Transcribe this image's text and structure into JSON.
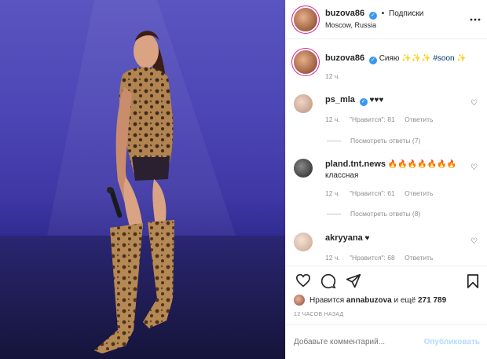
{
  "post": {
    "username": "buzova86",
    "follow_label": "Подписки",
    "location": "Moscow, Russia",
    "more_icon": "more-horizontal-icon",
    "caption": {
      "username": "buzova86",
      "text": "Сияю ✨✨✨",
      "hashtag": "#soon",
      "emoji": "✨",
      "time": "12 ч."
    }
  },
  "comments": [
    {
      "username": "ps_mla",
      "verified": true,
      "text": "♥♥♥",
      "time": "12 ч.",
      "likes": "\"Нравится\": 81",
      "reply_label": "Ответить",
      "view_replies": "Посмотреть ответы (7)"
    },
    {
      "username": "pland.tnt.news",
      "verified": false,
      "text": "🔥🔥🔥🔥🔥🔥🔥",
      "text2": "классная",
      "time": "12 ч.",
      "likes": "\"Нравится\": 61",
      "reply_label": "Ответить",
      "view_replies": "Посмотреть ответы (8)"
    },
    {
      "username": "akryyana",
      "verified": false,
      "text": "♥",
      "time": "12 ч.",
      "likes": "\"Нравится\": 68",
      "reply_label": "Ответить"
    }
  ],
  "likes": {
    "prefix": "Нравится",
    "user": "annabuzova",
    "middle": "и ещё",
    "count": "271 789"
  },
  "time_ago": "12 ЧАСОВ НАЗАД",
  "add_comment": {
    "placeholder": "Добавьте комментарий...",
    "post_label": "Опубликовать"
  },
  "colors": {
    "verified": "#3897f0",
    "link": "#00376b",
    "muted": "#8e8e8e",
    "post_disabled": "#b3dbff"
  }
}
